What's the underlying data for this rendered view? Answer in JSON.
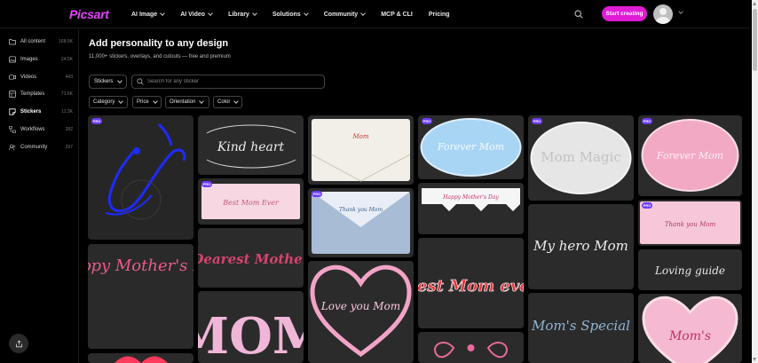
{
  "brand": {
    "name": "Picsart",
    "accent": "#e01cd5"
  },
  "nav": {
    "items": [
      {
        "label": "AI Image",
        "dropdown": true
      },
      {
        "label": "AI Video",
        "dropdown": true
      },
      {
        "label": "Library",
        "dropdown": true
      },
      {
        "label": "Solutions",
        "dropdown": true
      },
      {
        "label": "Community",
        "dropdown": true
      },
      {
        "label": "MCP & CLI",
        "dropdown": false
      },
      {
        "label": "Pricing",
        "dropdown": false
      }
    ],
    "start_button": "Start creating"
  },
  "sidebar": {
    "items": [
      {
        "label": "All content",
        "count": "168.5K",
        "icon": "folder-icon"
      },
      {
        "label": "Images",
        "count": "24.5K",
        "icon": "image-icon"
      },
      {
        "label": "Videos",
        "count": "443",
        "icon": "video-icon"
      },
      {
        "label": "Templates",
        "count": "71.5K",
        "icon": "template-icon"
      },
      {
        "label": "Stickers",
        "count": "11.3K",
        "icon": "sticker-icon",
        "active": true
      },
      {
        "label": "Workflows",
        "count": "282",
        "icon": "workflow-icon"
      },
      {
        "label": "Community",
        "count": "297",
        "icon": "community-icon"
      }
    ]
  },
  "main": {
    "title": "Add personality to any design",
    "subtitle": "11,000+ stickers, overlays, and cutouts — free and premium",
    "type_select": "Stickers",
    "search_placeholder": "Search for any sticker",
    "filters": [
      "Category",
      "Price",
      "Orientation",
      "Color"
    ]
  },
  "pro_badge": "PRO",
  "stickers": [
    {
      "text": "",
      "pro": true
    },
    {
      "text": "Kind heart",
      "pro": false
    },
    {
      "text": "Mom",
      "pro": false
    },
    {
      "text": "Forever Mom",
      "pro": true
    },
    {
      "text": "Mom Magic",
      "pro": true
    },
    {
      "text": "Forever Mom",
      "pro": true
    },
    {
      "text": "Best Mom Ever",
      "pro": true
    },
    {
      "text": "Thank you Mom",
      "pro": true
    },
    {
      "text": "Happy Mother's Day",
      "pro": true
    },
    {
      "text": "Thank you Mom",
      "pro": true
    },
    {
      "text": "Dearest Mother",
      "pro": false
    },
    {
      "text": "My hero Mom",
      "pro": false
    },
    {
      "text": "Loving guide",
      "pro": false
    },
    {
      "text": "Happy Mother's Day",
      "pro": false
    },
    {
      "text": "Love you Mom",
      "pro": false
    },
    {
      "text": "Best Mom ever",
      "pro": false
    },
    {
      "text": "Mom's",
      "pro": false
    },
    {
      "text": "MOM",
      "pro": false
    },
    {
      "text": "Mom's Special",
      "pro": false
    }
  ]
}
